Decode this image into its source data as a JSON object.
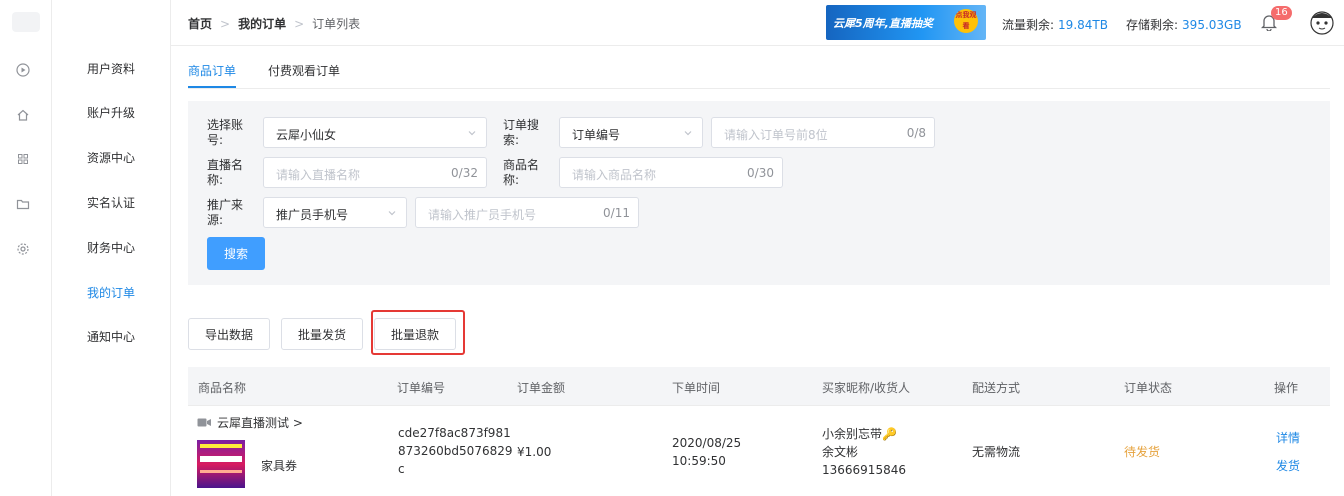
{
  "breadcrumb": {
    "home": "首页",
    "mid": "我的订单",
    "current": "订单列表"
  },
  "banner": {
    "text": "云犀5周年,直播抽奖",
    "coin": "点我观看"
  },
  "quota": {
    "traffic_label": "流量剩余:",
    "traffic_value": "19.84TB",
    "storage_label": "存储剩余:",
    "storage_value": "395.03GB"
  },
  "notifications": {
    "count": "16"
  },
  "menu": [
    "用户资料",
    "账户升级",
    "资源中心",
    "实名认证",
    "财务中心",
    "我的订单",
    "通知中心"
  ],
  "tabs": [
    "商品订单",
    "付费观看订单"
  ],
  "filters": {
    "account_label": "选择账号:",
    "account_value": "云犀小仙女",
    "order_search_label": "订单搜索:",
    "order_search_type": "订单编号",
    "order_no_placeholder": "请输入订单号前8位",
    "order_no_count": "0/8",
    "live_label": "直播名称:",
    "live_placeholder": "请输入直播名称",
    "live_count": "0/32",
    "product_label": "商品名称:",
    "product_placeholder": "请输入商品名称",
    "product_count": "0/30",
    "source_label": "推广来源:",
    "source_value": "推广员手机号",
    "phone_placeholder": "请输入推广员手机号",
    "phone_count": "0/11",
    "search_button": "搜索"
  },
  "actions": {
    "export": "导出数据",
    "batch_ship": "批量发货",
    "batch_refund": "批量退款"
  },
  "table": {
    "headers": [
      "商品名称",
      "订单编号",
      "订单金额",
      "下单时间",
      "买家昵称/收货人",
      "配送方式",
      "订单状态",
      "操作"
    ],
    "row": {
      "live_name": "云犀直播测试 >",
      "product": "家具券",
      "order_no_1": "cde27f8ac873f981",
      "order_no_2": "873260bd5076829",
      "order_no_3": "c",
      "amount": "¥1.00",
      "date": "2020/08/25",
      "time": "10:59:50",
      "buyer_nick": "小余别忘带🔑",
      "buyer_name": "余文彬",
      "buyer_phone": "13666915846",
      "delivery": "无需物流",
      "status": "待发货",
      "op_detail": "详情",
      "op_ship": "发货"
    }
  },
  "colors": {
    "accent": "#1e88e5",
    "warning": "#e6a23c",
    "highlight": "#e53935"
  }
}
